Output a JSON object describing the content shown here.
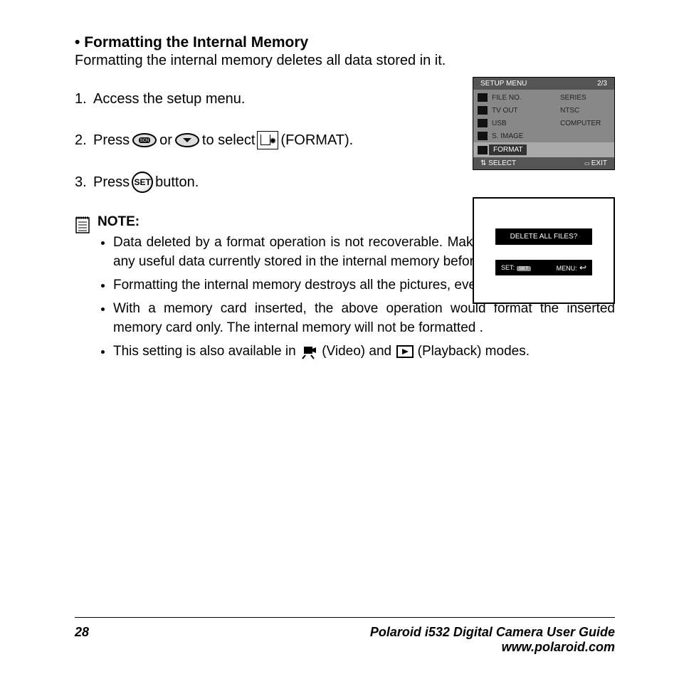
{
  "section": {
    "title": "Formatting the Internal Memory",
    "intro": "Formatting the internal memory deletes all data stored in it."
  },
  "steps": {
    "s1": "Access the setup menu.",
    "s2a": "Press",
    "s2b": "or",
    "s2c": "to select",
    "s2d": "(FORMAT).",
    "s3a": "Press",
    "s3b": "button."
  },
  "lcd1": {
    "title": "SETUP MENU",
    "page": "2/3",
    "rows": [
      {
        "label": "FILE NO.",
        "value": "SERIES"
      },
      {
        "label": "TV OUT",
        "value": "NTSC"
      },
      {
        "label": "USB",
        "value": "COMPUTER"
      },
      {
        "label": "S. IMAGE",
        "value": ""
      },
      {
        "label": "FORMAT",
        "value": ""
      }
    ],
    "foot_left": "SELECT",
    "foot_right": "EXIT"
  },
  "lcd2": {
    "question": "DELETE ALL FILES?",
    "set": "SET:",
    "set_btn": "SET",
    "menu": "MENU:"
  },
  "note": {
    "heading": "NOTE:",
    "items": [
      "Data deleted by a format operation is not recoverable. Make sure you do not have any useful data currently stored in the internal memory before you format it.",
      "Formatting the internal memory destroys all the pictures, even those are protected.",
      "With a memory card inserted, the above operation would format the inserted memory card only. The internal memory will not be formatted .",
      "This setting is also available in  (Video) and  (Playback) modes."
    ],
    "item4_pre": "This setting is also available in",
    "item4_video": "(Video) and",
    "item4_play": "(Playback) modes."
  },
  "footer": {
    "page": "28",
    "guide": "Polaroid i532 Digital Camera User Guide",
    "url": "www.polaroid.com"
  }
}
